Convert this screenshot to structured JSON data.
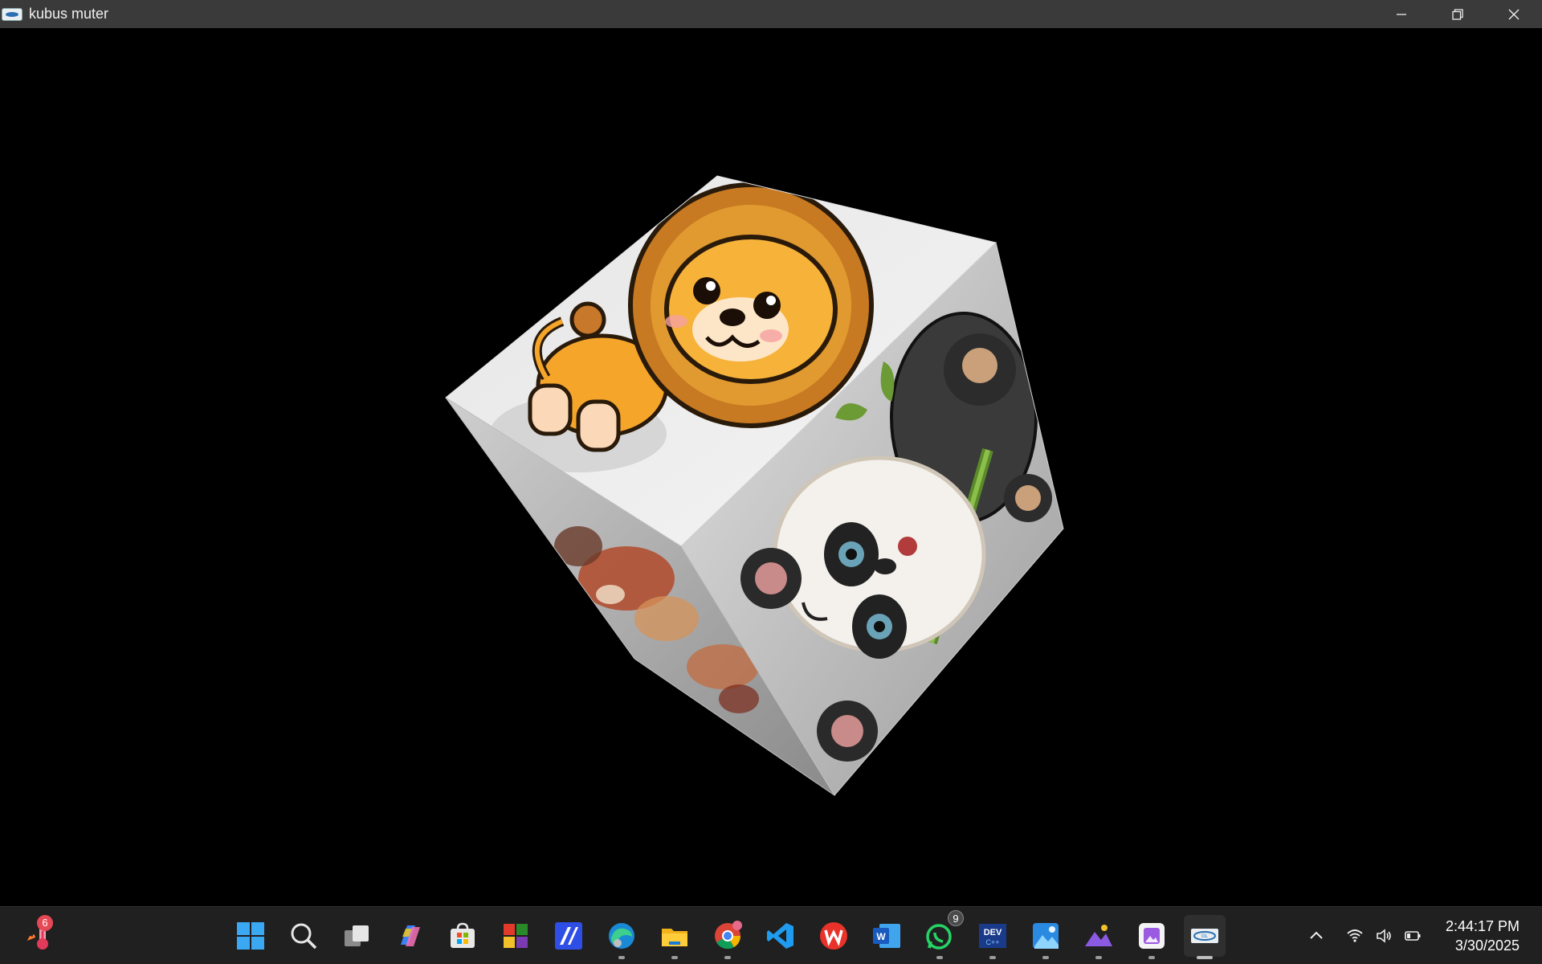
{
  "window": {
    "title": "kubus muter",
    "controls": [
      "minimize",
      "restore",
      "close"
    ]
  },
  "scene": {
    "object": "rotating textured cube",
    "faces": {
      "top": "lion-cartoon",
      "right": "panda-cartoon",
      "left": "animal-cartoon"
    },
    "background": "#000000"
  },
  "taskbar": {
    "widget_badge": "6",
    "apps": [
      {
        "name": "start",
        "icon": "windows-logo-icon",
        "running": false
      },
      {
        "name": "search",
        "icon": "search-icon",
        "running": false
      },
      {
        "name": "task-view",
        "icon": "task-view-icon",
        "running": false
      },
      {
        "name": "copilot",
        "icon": "copilot-icon",
        "running": false
      },
      {
        "name": "microsoft-store",
        "icon": "store-icon",
        "running": false
      },
      {
        "name": "blocks-app",
        "icon": "color-blocks-icon",
        "running": false
      },
      {
        "name": "editor-app",
        "icon": "blue-editor-icon",
        "running": false
      },
      {
        "name": "edge",
        "icon": "edge-icon",
        "running": true
      },
      {
        "name": "file-explorer",
        "icon": "folder-icon",
        "running": true
      },
      {
        "name": "chrome",
        "icon": "chrome-icon",
        "running": true
      },
      {
        "name": "vs-code",
        "icon": "vscode-icon",
        "running": false
      },
      {
        "name": "wps-office",
        "icon": "wps-icon",
        "running": false
      },
      {
        "name": "word",
        "icon": "word-icon",
        "running": false
      },
      {
        "name": "whatsapp",
        "icon": "whatsapp-icon",
        "running": true,
        "badge": "9"
      },
      {
        "name": "dev-cpp",
        "icon": "dev-icon",
        "running": true
      },
      {
        "name": "photos",
        "icon": "photos-icon",
        "running": true
      },
      {
        "name": "paint-app",
        "icon": "mountain-icon",
        "running": true
      },
      {
        "name": "gallery-app",
        "icon": "purple-gallery-icon",
        "running": true
      },
      {
        "name": "kubus-muter",
        "icon": "opengl-app-icon",
        "running": true,
        "active": true
      }
    ],
    "tray": {
      "time": "2:44:17 PM",
      "date": "3/30/2025"
    },
    "colors": {
      "taskbar_bg": "#202020",
      "titlebar_bg": "#3a3a3a",
      "badge_red": "#e74856"
    }
  }
}
